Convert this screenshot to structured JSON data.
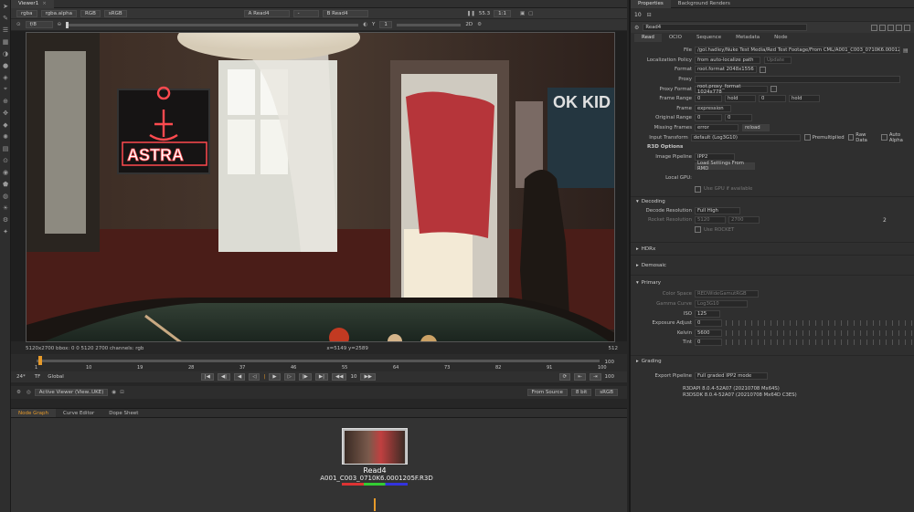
{
  "toolbar_icons": [
    "pointer-icon",
    "paint-icon",
    "layers-icon",
    "image-icon",
    "channel-icon",
    "color-icon",
    "filter-icon",
    "keyer-icon",
    "merge-icon",
    "transform-icon",
    "3d-icon",
    "particles-icon",
    "deep-icon",
    "views-icon",
    "metadata-icon",
    "toolsets-icon",
    "other-icon",
    "furnace-icon",
    "cara-icon",
    "settings-icon"
  ],
  "viewer": {
    "tab": "Viewer1",
    "channels": "rgba",
    "alpha": "rgba.alpha",
    "mode": "RGB",
    "colorspace": "sRGB",
    "input_a": "A  Read4",
    "input_a_op": "-",
    "input_b": "B  Read4",
    "fps": "55.3",
    "zoom": "1:1",
    "frame_start": "f/8",
    "frame_num": "1",
    "y_label": "Y",
    "y_val": "1",
    "view_mode": "2D",
    "resolution": "5120x2700  bbox: 0 0 5120 2700 channels: rgb",
    "coords": "x=5149 y=2589",
    "right_info": "512",
    "poster_text": "OK KID",
    "sign_text": "ASTRA"
  },
  "timeline": {
    "ticks": [
      "1",
      "10",
      "19",
      "28",
      "37",
      "46",
      "55",
      "64",
      "73",
      "82",
      "91",
      "100"
    ],
    "end": "100",
    "fps_label": "24*",
    "tf_label": "TF",
    "scope": "Global",
    "step": "10",
    "end2": "100"
  },
  "viewer_footer": {
    "active_viewer": "Active Viewer (View..UKE)",
    "from_source": "From Source",
    "bits": "8 bit",
    "output": "sRGB"
  },
  "nodegraph": {
    "tabs": [
      "Node Graph",
      "Curve Editor",
      "Dope Sheet"
    ],
    "node_name": "Read4",
    "node_file": "A001_C003_0710K6.0001205F.R3D"
  },
  "properties": {
    "tabs": [
      "Properties",
      "Background Renders"
    ],
    "node_name": "Read4",
    "subtabs": [
      "Read",
      "OCIO",
      "Sequence",
      "Metadata",
      "Node"
    ],
    "file": "/gol.hadley/Nuke Test Media/Red Test Footage/From CML/A001_C003_0710K6.0001205F.R3D",
    "localization_policy": "from auto-localize path",
    "localization_btn": "Update",
    "format": "root.format 2048x1556",
    "proxy": "",
    "proxy_format": "root.proxy_format 1024x778",
    "frame_range_a": "0",
    "frame_range_mode_a": "hold",
    "frame_range_b": "0",
    "frame_range_mode_b": "hold",
    "frame": "expression",
    "original_range_a": "0",
    "original_range_b": "0",
    "missing_frames": "error",
    "reload": "reload",
    "input_transform": "default (Log3G10)",
    "premultiplied": "Premultiplied",
    "raw_data": "Raw Data",
    "auto_alpha": "Auto Alpha",
    "r3d_options": "R3D Options",
    "image_pipeline": "IPP2",
    "load_settings": "Load Settings From RMD",
    "local_gpu": "Local GPU:",
    "use_gpu": "Use GPU if available",
    "decoding": "Decoding",
    "decode_resolution": "Full High",
    "rocket_res_a": "5120",
    "rocket_res_b": "2700",
    "rocket_res_c": "2",
    "use_rocket": "Use ROCKET",
    "hdrx": "HDRx",
    "demosaic": "Demosaic",
    "primary": "Primary",
    "color_space": "REDWideGamutRGB",
    "gamma_curve": "Log3G10",
    "iso": "125",
    "exposure_adjust": "0",
    "kelvin": "5600",
    "tint": "0",
    "grading": "Grading",
    "export_pipeline": "Full graded IPP2 mode",
    "r3dapi": "R3DAPI 8.0.4-52A07 (20210708 Mx64S)",
    "r3dsdk": "R3DSDK 8.0.4-52A07 (20210708 Mx64D C3ES)",
    "labels": {
      "file": "File",
      "localization": "Localization Policy",
      "format": "Format",
      "proxy": "Proxy",
      "proxy_format": "Proxy Format",
      "frame_range": "Frame Range",
      "frame": "Frame",
      "original_range": "Original Range",
      "missing_frames": "Missing Frames",
      "input_transform": "Input Transform",
      "image_pipeline": "Image Pipeline",
      "decode_resolution": "Decode Resolution",
      "rocket_resolution": "Rocket Resolution",
      "color_space": "Color Space",
      "gamma_curve": "Gamma Curve",
      "iso": "ISO",
      "exposure_adjust": "Exposure Adjust",
      "kelvin": "Kelvin",
      "tint": "Tint",
      "export_pipeline": "Export Pipeline",
      "panel_count": "10"
    }
  }
}
